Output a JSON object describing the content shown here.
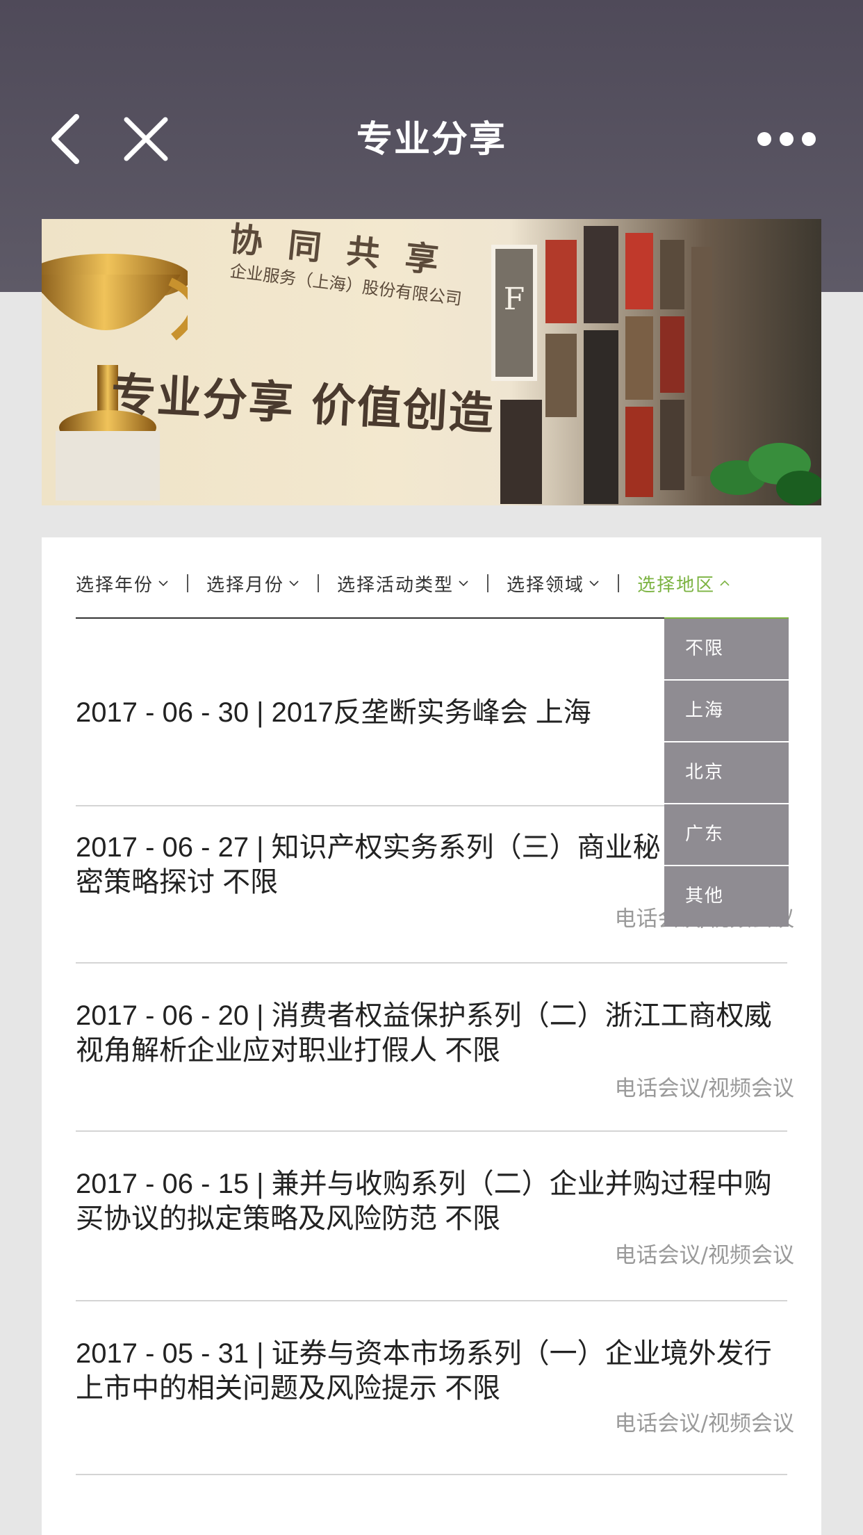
{
  "nav": {
    "title": "专业分享"
  },
  "banner": {
    "line1": "协 同 共 享",
    "line2": "企业服务（上海）股份有限公司",
    "line3": "专业分享 价值创造",
    "frame_letter": "F"
  },
  "filters": [
    {
      "label": "选择年份",
      "active": false
    },
    {
      "label": "选择月份",
      "active": false
    },
    {
      "label": "选择活动类型",
      "active": false
    },
    {
      "label": "选择领域",
      "active": false
    },
    {
      "label": "选择地区",
      "active": true
    }
  ],
  "dropdown": {
    "options": [
      "不限",
      "上海",
      "北京",
      "广东",
      "其他"
    ]
  },
  "items": [
    {
      "title": "2017 - 06 - 30 | 2017反垄断实务峰会  上海",
      "meta": ""
    },
    {
      "title": "2017 - 06 - 27 | 知识产权实务系列（三）商业秘密策略探讨  不限",
      "meta": "电话会议/视频会议"
    },
    {
      "title": "2017 - 06 - 20 | 消费者权益保护系列（二）浙江工商权威视角解析企业应对职业打假人  不限",
      "meta": "电话会议/视频会议"
    },
    {
      "title": "2017 - 06 - 15 | 兼并与收购系列（二）企业并购过程中购买协议的拟定策略及风险防范  不限",
      "meta": "电话会议/视频会议"
    },
    {
      "title": "2017 - 05 - 31 | 证券与资本市场系列（一）企业境外发行上市中的相关问题及风险提示  不限",
      "meta": "电话会议/视频会议"
    }
  ],
  "colors": {
    "header": "#565161",
    "accent": "#7cb342",
    "dropdown_bg": "#8f8c92"
  }
}
